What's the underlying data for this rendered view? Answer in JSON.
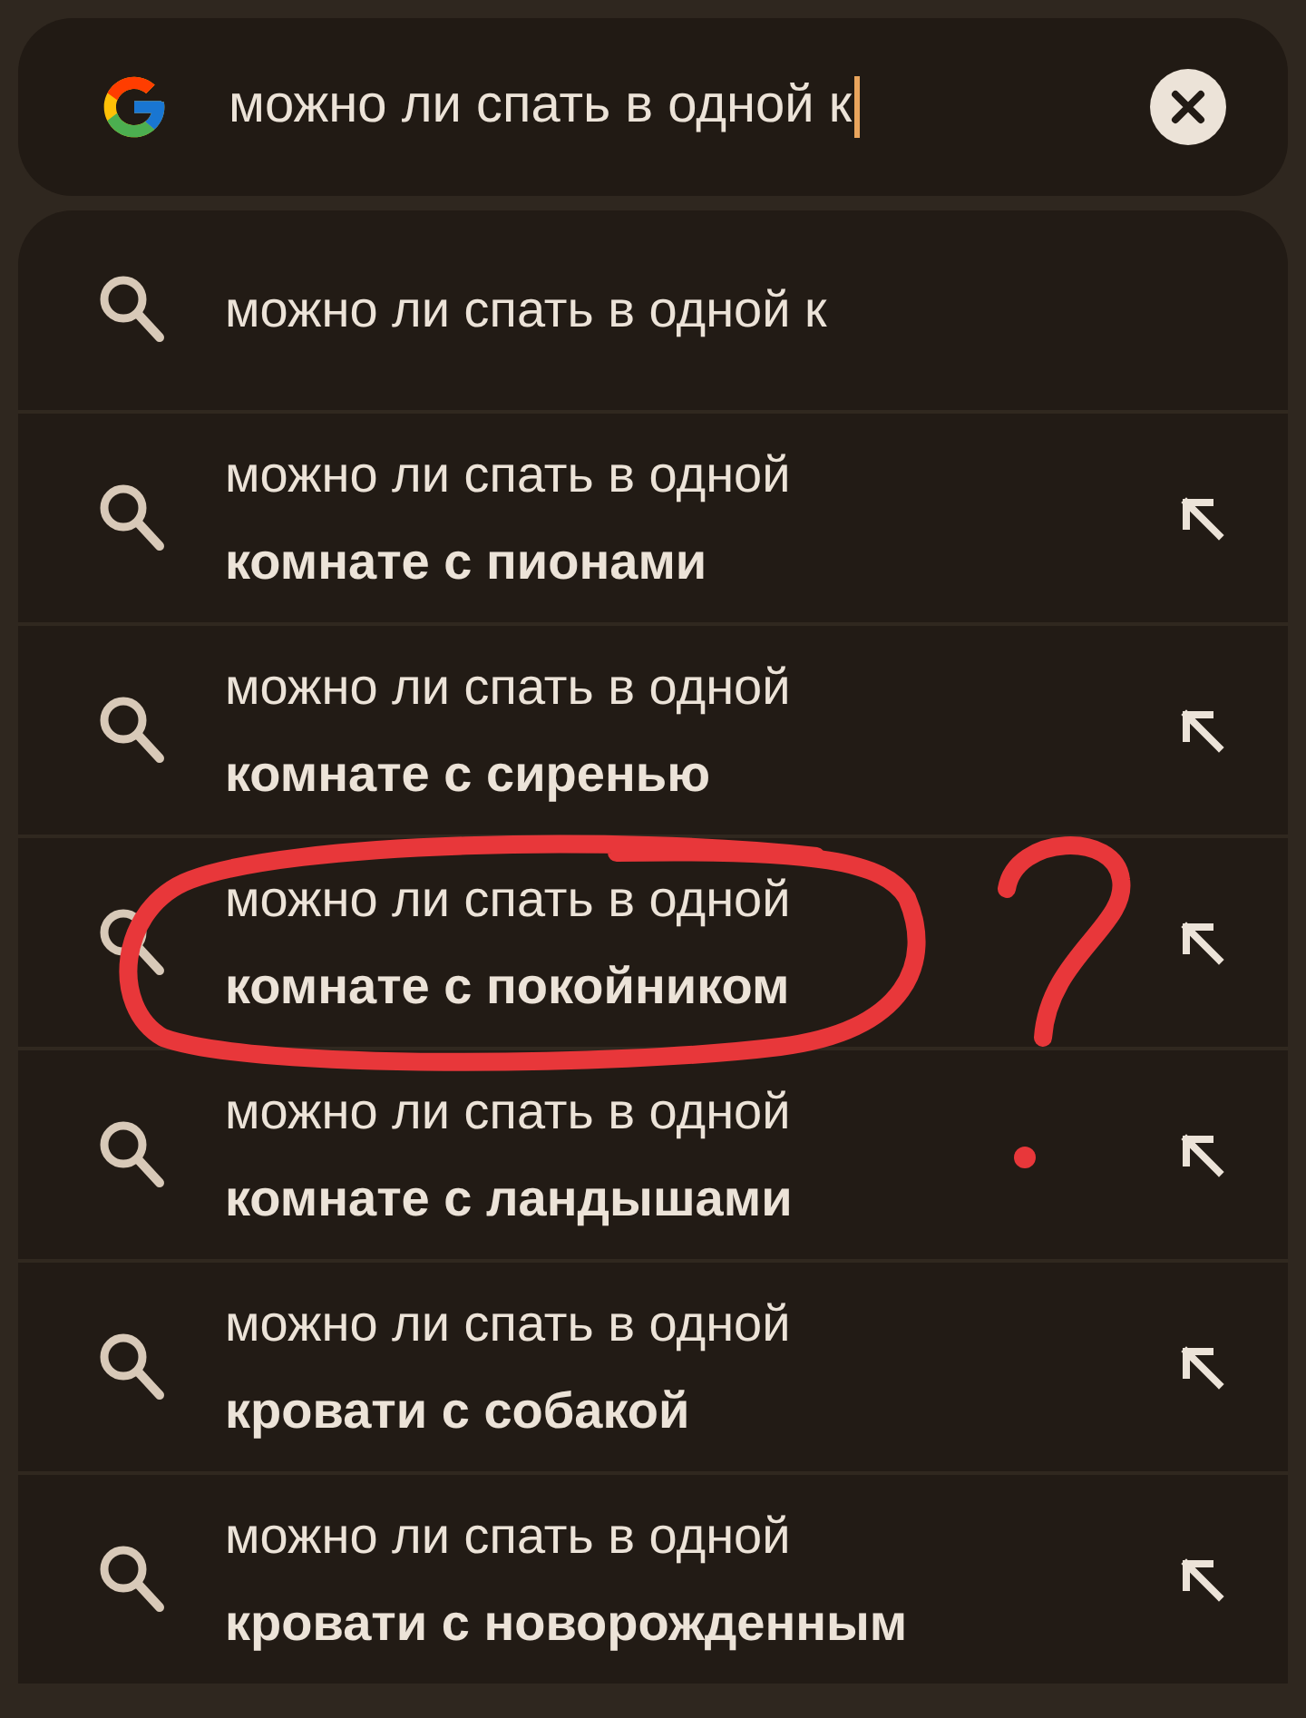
{
  "search": {
    "value": "можно ли спать в одной к"
  },
  "suggestions": [
    {
      "kind": "typed",
      "line_1": "можно ли спать в одной к",
      "circled": false
    },
    {
      "kind": "completion",
      "line_1": "можно ли спать в одной",
      "line_2": "комнате с пионами",
      "circled": false
    },
    {
      "kind": "completion",
      "line_1": "можно ли спать в одной",
      "line_2": "комнате с сиренью",
      "circled": false
    },
    {
      "kind": "completion",
      "line_1": "можно ли спать в одной",
      "line_2": "комнате с покойником",
      "circled": true
    },
    {
      "kind": "completion",
      "line_1": "можно ли спать в одной",
      "line_2": "комнате с ландышами",
      "circled": false
    },
    {
      "kind": "completion",
      "line_1": "можно ли спать в одной",
      "line_2": "кровати с собакой",
      "circled": false
    },
    {
      "kind": "completion",
      "line_1": "можно ли спать в одной",
      "line_2": "кровати с новорожденным",
      "circled": false
    }
  ]
}
